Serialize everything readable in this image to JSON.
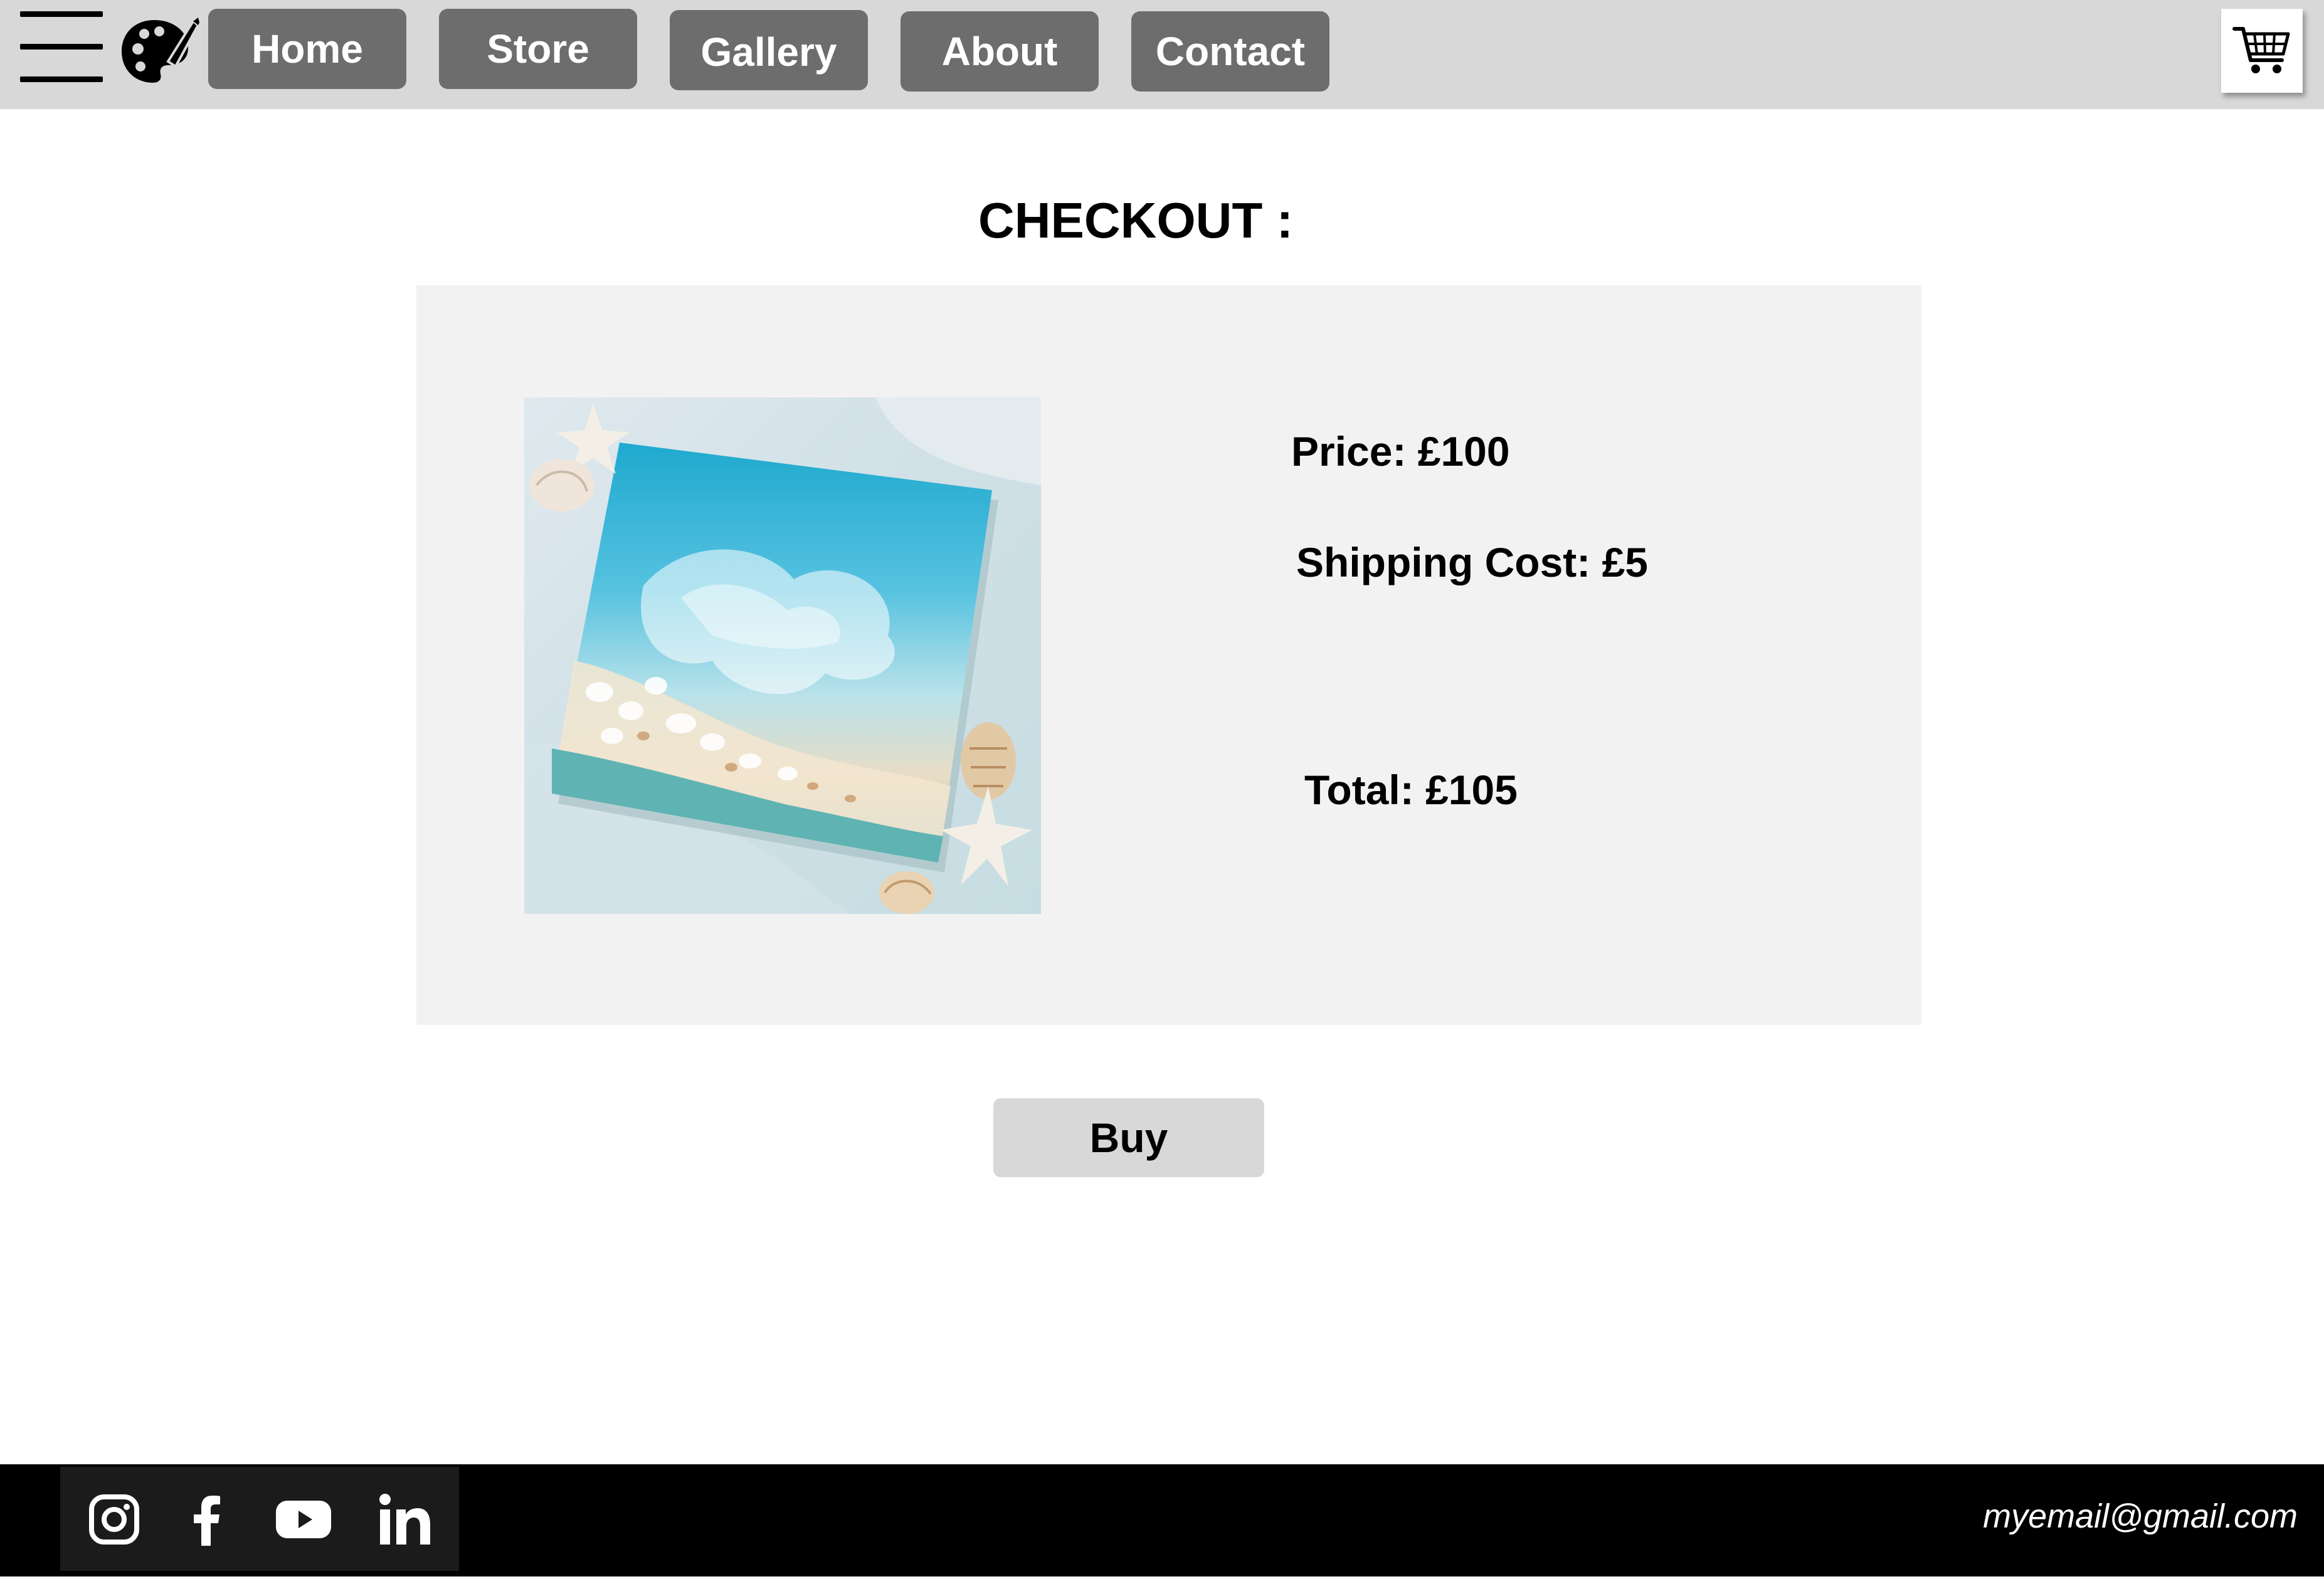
{
  "header": {
    "menu_icon": "hamburger-menu-icon",
    "logo_icon": "paint-palette-icon",
    "nav": [
      {
        "label": "Home"
      },
      {
        "label": "Store"
      },
      {
        "label": "Gallery"
      },
      {
        "label": "About"
      },
      {
        "label": "Contact"
      }
    ],
    "cart_icon": "shopping-cart-icon"
  },
  "checkout": {
    "title": "CHECKOUT :",
    "product_image": "ocean-resin-art-tile-with-seashells",
    "price": "Price: £100",
    "shipping": "Shipping Cost: £5",
    "total": "Total: £105",
    "buy_label": "Buy"
  },
  "footer": {
    "social": [
      "instagram-icon",
      "facebook-icon",
      "youtube-icon",
      "linkedin-icon"
    ],
    "email": "myemail@gmail.com"
  },
  "colors": {
    "header_bg": "#d8d8d8",
    "nav_button_bg": "#6d6d6d",
    "card_bg": "#f2f2f2",
    "buy_button_bg": "#d8d8d8",
    "footer_bg": "#000000"
  }
}
